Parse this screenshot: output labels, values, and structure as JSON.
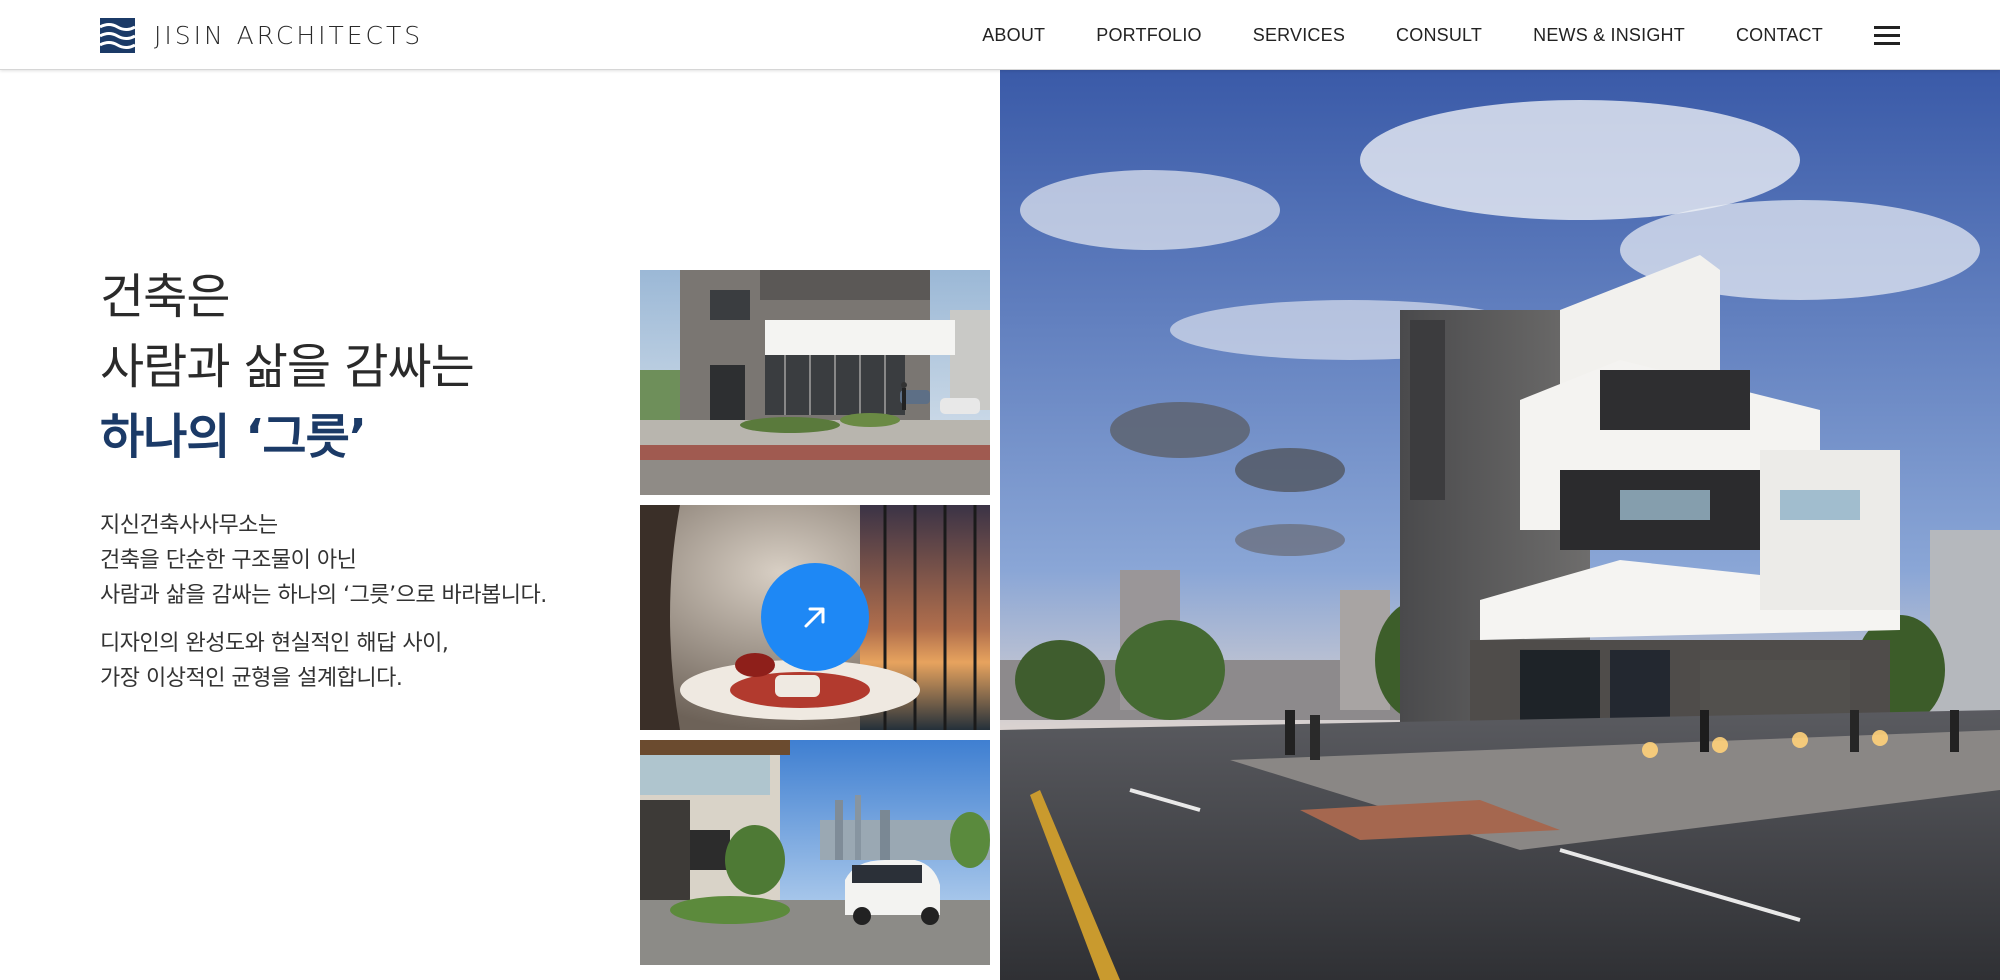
{
  "brand": {
    "name": "JISIN ARCHITECTS",
    "logo_icon": "waves-logo-icon",
    "color": "#1b3a67"
  },
  "nav": {
    "items": [
      "ABOUT",
      "PORTFOLIO",
      "SERVICES",
      "CONSULT",
      "NEWS & INSIGHT",
      "CONTACT"
    ],
    "menu_icon": "hamburger-menu-icon"
  },
  "hero": {
    "line1": "건축은",
    "line2": "사람과 삶을 감싸는",
    "line3": "하나의 ‘그릇’",
    "accent_color": "#1b3a67"
  },
  "description": {
    "para1": [
      "지신건축사사무소는",
      "건축을 단순한 구조물이 아닌",
      "사람과 삶을 감싸는 하나의 ‘그릇’으로 바라봅니다."
    ],
    "para2": [
      "디자인의 완성도와 현실적인 해답 사이,",
      "가장 이상적인 균형을 설계합니다."
    ]
  },
  "gallery": {
    "thumbnails": [
      "building-entrance-photo",
      "lounge-interior-photo",
      "villa-driveway-photo"
    ],
    "arrow_button_icon": "arrow-up-right-icon",
    "arrow_button_color": "#1e88f5"
  },
  "main_image": {
    "subject": "modern-building-street-photo"
  }
}
